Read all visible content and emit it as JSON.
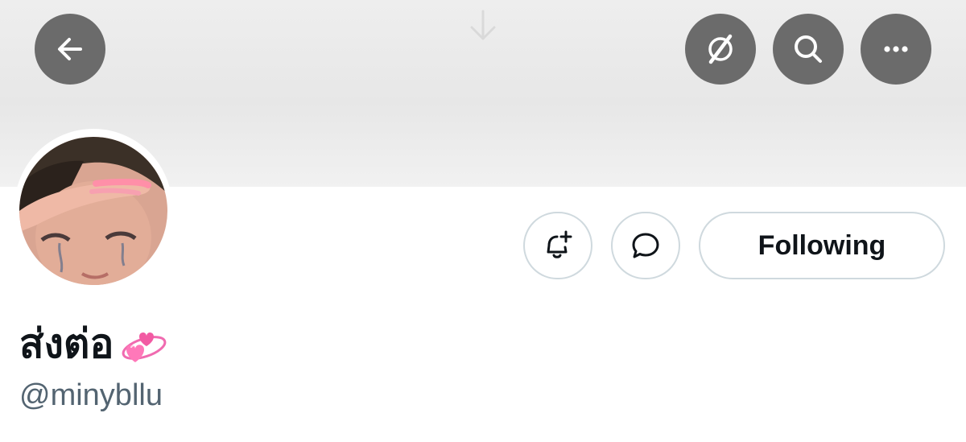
{
  "header": {
    "back_icon": "arrow-left-icon",
    "grok_icon": "slashed-circle-icon",
    "search_icon": "search-icon",
    "more_icon": "more-horizontal-icon",
    "pull_indicator_icon": "arrow-down-icon"
  },
  "profile": {
    "display_name": "ส่งต่อ",
    "display_name_emoji": "revolving-hearts-icon",
    "handle": "@minybllu"
  },
  "actions": {
    "notify_icon": "bell-plus-icon",
    "message_icon": "message-bubble-icon",
    "following_label": "Following"
  },
  "colors": {
    "header_button_bg": "#6b6b6b",
    "outline_border": "#cfd9de",
    "text_primary": "#0f1419",
    "text_secondary": "#536471"
  }
}
